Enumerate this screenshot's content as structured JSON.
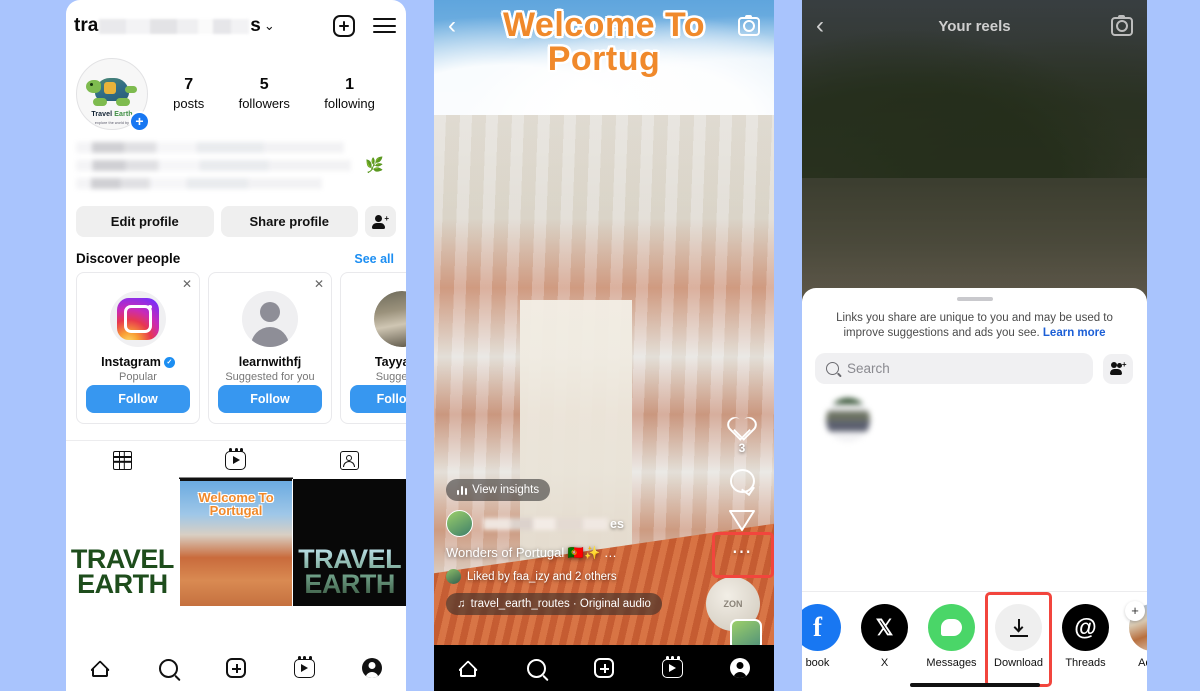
{
  "app": "Instagram",
  "background_color": "#a9c4fd",
  "profile_panel": {
    "header": {
      "username_visible_prefix": "tra",
      "username_visible_suffix": "s",
      "username_blurred": true,
      "chevron": "⌄",
      "new_post_icon": "plus-square-icon",
      "menu_icon": "hamburger-icon"
    },
    "avatar": {
      "brand_text_1": "Travel",
      "brand_text_2": "Earth",
      "brand_tagline": "explore the world by",
      "add_story_badge": "+"
    },
    "stats": [
      {
        "num": "7",
        "label": "posts"
      },
      {
        "num": "5",
        "label": "followers"
      },
      {
        "num": "1",
        "label": "following"
      }
    ],
    "bio_blurred": true,
    "bio_emoji": "🌿",
    "buttons": {
      "edit_profile": "Edit profile",
      "share_profile": "Share profile",
      "add_people_icon": "add-person-icon"
    },
    "discover": {
      "title": "Discover people",
      "see_all": "See all",
      "cards": [
        {
          "name": "Instagram",
          "verified": true,
          "subtitle": "Popular",
          "follow": "Follow",
          "avatar": "instagram-logo"
        },
        {
          "name": "learnwithfj",
          "verified": false,
          "subtitle": "Suggested for you",
          "follow": "Follow",
          "avatar": "default-person"
        },
        {
          "name": "Tayyab A",
          "verified": false,
          "subtitle": "Suggested",
          "follow": "Follow b",
          "avatar": "photo"
        }
      ]
    },
    "tabs": [
      {
        "name": "grid",
        "icon": "grid-icon",
        "active": false
      },
      {
        "name": "reels",
        "icon": "reels-icon",
        "active": true
      },
      {
        "name": "tagged",
        "icon": "tagged-icon",
        "active": false
      }
    ],
    "grid": [
      {
        "type": "white",
        "text": "TRAVEL\nEARTH",
        "title_line1": "TRAVEL",
        "title_line2": "EARTH"
      },
      {
        "type": "photo",
        "overlay_line1": "Welcome To",
        "overlay_line2": "Portugal"
      },
      {
        "type": "dark",
        "title_line1": "TRAVEL",
        "title_line2": "EARTH"
      }
    ],
    "nav": [
      {
        "name": "home",
        "icon": "home-icon"
      },
      {
        "name": "search",
        "icon": "search-icon"
      },
      {
        "name": "create",
        "icon": "plus-square-icon"
      },
      {
        "name": "reels",
        "icon": "reels-icon"
      },
      {
        "name": "profile",
        "icon": "profile-icon"
      }
    ]
  },
  "reel_panel": {
    "top": {
      "back_icon": "chevron-left-icon",
      "title": "Your reels",
      "camera_icon": "camera-icon"
    },
    "overlay_title_line1": "Welcome To",
    "overlay_title_line2": "Portug",
    "insights_pill": "View insights",
    "username_blurred": true,
    "username_suffix": "es",
    "caption": "Wonders of Portugal 🇵🇹✨ …",
    "liked_by": "Liked by faa_izy and 2 others",
    "audio": "travel_earth_routes · Original audio",
    "actions": {
      "like_icon": "heart-icon",
      "like_count": "3",
      "comment_icon": "comment-icon",
      "share_icon": "share-paperplane-icon",
      "more_icon": "more-dots-icon"
    },
    "share_highlight_color": "#f2453d",
    "nav": [
      {
        "name": "home",
        "icon": "home-icon"
      },
      {
        "name": "search",
        "icon": "search-icon"
      },
      {
        "name": "create",
        "icon": "plus-square-icon"
      },
      {
        "name": "reels",
        "icon": "reels-icon"
      },
      {
        "name": "profile",
        "icon": "profile-icon"
      }
    ]
  },
  "share_panel": {
    "top": {
      "back_icon": "chevron-left-icon",
      "title": "Your reels",
      "camera_icon": "camera-icon"
    },
    "sheet": {
      "note_text": "Links you share are unique to you and may be used to improve suggestions and ads you see.",
      "note_link": "Learn more",
      "search_placeholder": "Search",
      "search_value": "",
      "search_icon": "search-icon",
      "add_people_icon": "add-people-icon",
      "contacts_blurred": true
    },
    "apps": [
      {
        "label": "book",
        "icon": "facebook-icon",
        "highlighted": false
      },
      {
        "label": "X",
        "icon": "x-icon",
        "highlighted": false
      },
      {
        "label": "Messages",
        "icon": "messages-icon",
        "highlighted": false
      },
      {
        "label": "Download",
        "icon": "download-icon",
        "highlighted": true
      },
      {
        "label": "Threads",
        "icon": "threads-icon",
        "highlighted": false
      },
      {
        "label": "Add n",
        "icon": "add-new-icon",
        "highlighted": false
      }
    ],
    "download_highlight_color": "#f2453d"
  }
}
